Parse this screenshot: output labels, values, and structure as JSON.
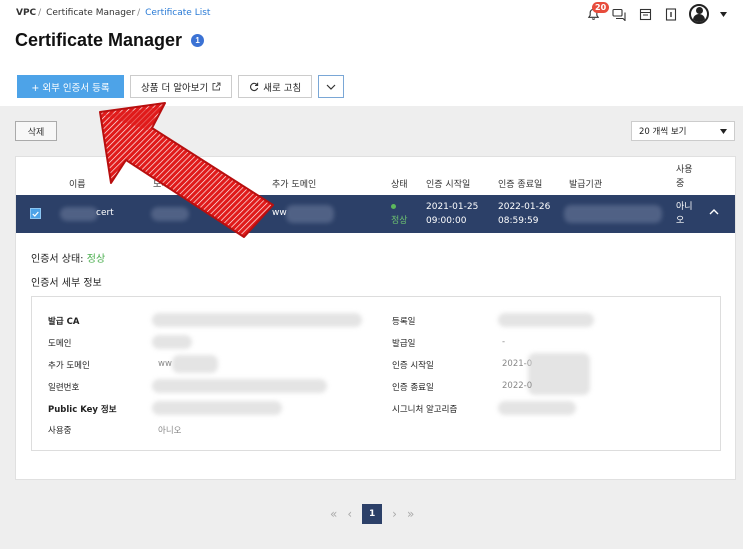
{
  "breadcrumb": {
    "root": "VPC",
    "section": "Certificate Manager",
    "current": "Certificate List"
  },
  "notifications": {
    "count": "20"
  },
  "page_title": "Certificate Manager",
  "title_badge": "1",
  "toolbar": {
    "register_label": "+ 외부 인증서 등록",
    "learn_more_label": "상품 더 알아보기",
    "refresh_label": "새로 고침"
  },
  "delete_label": "삭제",
  "page_size": {
    "selected": "20 개씩 보기"
  },
  "table": {
    "headers": {
      "name": "이름",
      "domain": "도메인",
      "extra_domain": "추가 도메인",
      "status": "상태",
      "start": "인증 시작일",
      "end": "인증 종료일",
      "issuer": "발급기관",
      "in_use_1": "사용",
      "in_use_2": "중"
    },
    "row": {
      "name": "cert",
      "extra_domain": "ww",
      "status": "정상",
      "start_date": "2021-01-25",
      "start_time": "09:00:00",
      "end_date": "2022-01-26",
      "end_time": "08:59:59",
      "in_use_1": "아니",
      "in_use_2": "오"
    }
  },
  "detail": {
    "status_label": "인증서 상태:",
    "status_value": "정상",
    "section_title": "인증서 세부 정보",
    "fields": {
      "ca_label": "발급 CA",
      "domain_label": "도메인",
      "extra_domain_label": "추가 도메인",
      "extra_domain_value": "ww",
      "serial_label": "일련번호",
      "pubkey_label": "Public Key 정보",
      "in_use_label": "사용중",
      "in_use_value": "아니오",
      "registered_label": "등록일",
      "issued_label": "발급일",
      "issued_value": "-",
      "start_label": "인증 시작일",
      "start_value": "2021-0",
      "end_label": "인증 종료일",
      "end_value": "2022-0",
      "sig_label": "시그니처 알고리즘"
    }
  },
  "pagination": {
    "current": "1"
  },
  "colors": {
    "selected_row": "#2c4068",
    "primary": "#4da3e8",
    "annotation_arrow": "#e01a1a"
  }
}
